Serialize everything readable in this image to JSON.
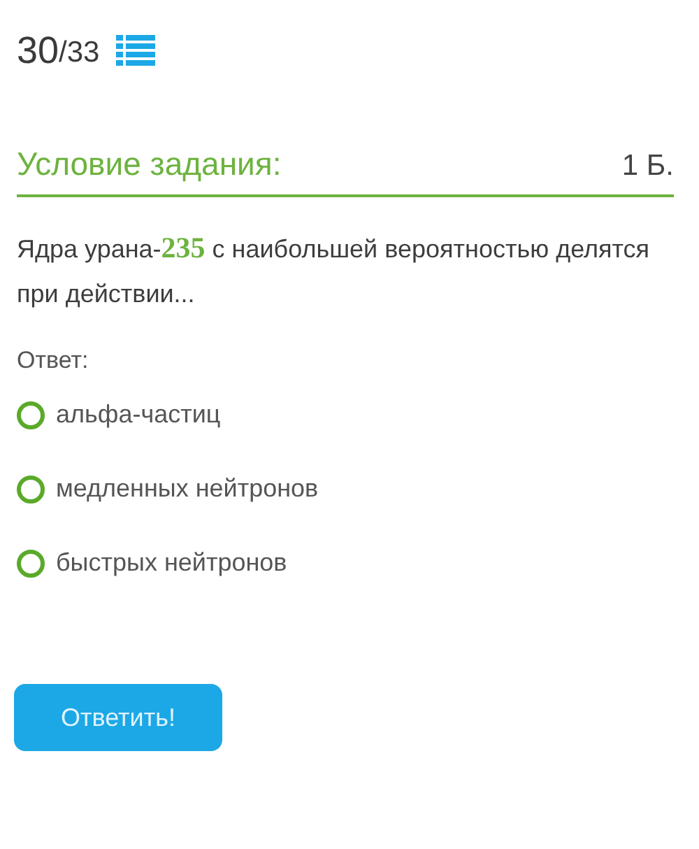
{
  "progress": {
    "current": "30",
    "total": "/33"
  },
  "task": {
    "title": "Условие задания:",
    "points": "1 Б.",
    "question": "Ядра урана-**235** с наибольшей вероятностью делятся при действии..."
  },
  "answer_label": "Ответ:",
  "options": [
    {
      "label": "альфа-частиц",
      "selected": false
    },
    {
      "label": "медленных нейтронов",
      "selected": false
    },
    {
      "label": "быстрых нейтронов",
      "selected": false
    }
  ],
  "submit_button": "Ответить!"
}
